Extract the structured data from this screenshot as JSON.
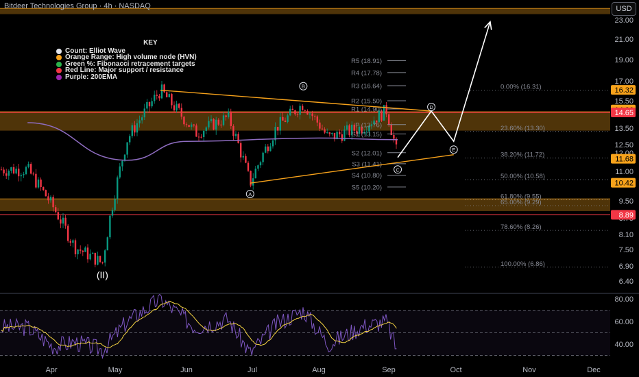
{
  "header": {
    "title": "Bitdeer Technologies Group · 4h · NASDAQ",
    "currency_button": "USD"
  },
  "key": {
    "title": "KEY",
    "items": [
      {
        "color": "#e0e3eb",
        "label": "Count: Elliot Wave"
      },
      {
        "color": "#f7a21b",
        "label": "Orange Range: High volume node (HVN)"
      },
      {
        "color": "#2bb24c",
        "label": "Green %: Fibonacci retracement targets"
      },
      {
        "color": "#f23645",
        "label": "Red Line: Major support / resistance"
      },
      {
        "color": "#9c27b0",
        "label": "Purple: 200EMA"
      }
    ]
  },
  "colors": {
    "up": "#089981",
    "down": "#f23645",
    "orange": "#f7a21b",
    "ema": "#8e6cc0",
    "pivot": "#868993",
    "fib": "#868993",
    "rsi": "#7e57c2",
    "rsi_ma": "#f5d442"
  },
  "chart_data": [
    {
      "type": "candlestick",
      "title": "Bitdeer Technologies Group · 4h · NASDAQ",
      "x_ticks": [
        "Apr",
        "May",
        "Jun",
        "Jul",
        "Aug",
        "Sep",
        "Oct",
        "Nov",
        "Dec"
      ],
      "y_ticks": [
        23.0,
        21.0,
        19.0,
        17.0,
        15.5,
        13.5,
        12.5,
        12.0,
        11.0,
        9.5,
        8.75,
        8.1,
        7.5,
        6.9,
        6.4
      ],
      "y_tick_labels": [
        "23.00",
        "21.00",
        "19.00",
        "17.00",
        "15.50",
        "13.50",
        "12.50",
        "12.00",
        "11.00",
        "9.50",
        "8.75",
        "8.10",
        "7.50",
        "6.90",
        "6.40"
      ],
      "price_labels": [
        {
          "value": "16.32",
          "color": "#f7a21b",
          "text": "#000"
        },
        {
          "value": "14.86",
          "color": "#f7a21b",
          "text": "#000"
        },
        {
          "value": "14.65",
          "color": "#f23645",
          "text": "#fff"
        },
        {
          "value": "11.68",
          "color": "#f7a21b",
          "text": "#000"
        },
        {
          "value": "10.42",
          "color": "#f7a21b",
          "text": "#000"
        },
        {
          "value": "8.89",
          "color": "#f23645",
          "text": "#fff"
        }
      ],
      "hvn_zones": [
        [
          23.6,
          24.2
        ],
        [
          13.35,
          14.7
        ],
        [
          9.05,
          9.6
        ]
      ],
      "red_lines": [
        14.65,
        8.89
      ],
      "pivots": [
        {
          "label": "R5 (18.91)",
          "value": 18.91
        },
        {
          "label": "R4 (17.78)",
          "value": 17.78
        },
        {
          "label": "R3 (16.64)",
          "value": 16.64
        },
        {
          "label": "R2 (15.50)",
          "value": 15.5
        },
        {
          "label": "R1 (14.90)",
          "value": 14.9
        },
        {
          "label": "P (13.76)",
          "value": 13.76
        },
        {
          "label": "S1 (13.15)",
          "value": 13.15
        },
        {
          "label": "S2 (12.01)",
          "value": 12.01
        },
        {
          "label": "S3 (11.41)",
          "value": 11.41
        },
        {
          "label": "S4 (10.80)",
          "value": 10.8
        },
        {
          "label": "S5 (10.20)",
          "value": 10.2
        }
      ],
      "fib_levels": [
        {
          "label": "0.00% (16.31)",
          "value": 16.31
        },
        {
          "label": "23.60% (13.30)",
          "value": 13.3
        },
        {
          "label": "38.20% (11.72)",
          "value": 11.72
        },
        {
          "label": "50.00% (10.58)",
          "value": 10.58
        },
        {
          "label": "61.80% (9.55)",
          "value": 9.55
        },
        {
          "label": "65.00% (9.29)",
          "value": 9.29
        },
        {
          "label": "78.60% (8.26)",
          "value": 8.26
        },
        {
          "label": "100.00% (6.86)",
          "value": 6.86
        }
      ],
      "wave_labels": [
        "(II)",
        "A",
        "B",
        "C",
        "D",
        "E"
      ],
      "triangle_lines": {
        "upper": [
          [
            "May 20",
            16.3
          ],
          [
            "Sep 20",
            14.75
          ]
        ],
        "lower": [
          [
            "Jun 30",
            10.4
          ],
          [
            "Sep 30",
            11.9
          ]
        ]
      },
      "projection_path": [
        [
          "Sep 05",
          11.75
        ],
        [
          "Sep 20",
          14.75
        ],
        [
          "Sep 30",
          12.7
        ],
        [
          "Oct 15",
          22.8
        ]
      ],
      "ohlc_key_points": [
        [
          "Mar 20",
          11.1
        ],
        [
          "Apr 02",
          9.2
        ],
        [
          "Apr 12",
          7.6
        ],
        [
          "Apr 25",
          7.0
        ],
        [
          "May 06",
          12.8
        ],
        [
          "May 20",
          16.3
        ],
        [
          "Jun 05",
          13.2
        ],
        [
          "Jun 20",
          14.3
        ],
        [
          "Jun 30",
          10.4
        ],
        [
          "Jul 12",
          13.6
        ],
        [
          "Jul 24",
          15.3
        ],
        [
          "Aug 05",
          12.9
        ],
        [
          "Aug 20",
          13.6
        ],
        [
          "Aug 30",
          14.8
        ],
        [
          "Sep 05",
          11.75
        ]
      ],
      "ema200_key_points": [
        [
          "Mar 20",
          13.9
        ],
        [
          "May 06",
          11.6
        ],
        [
          "Jun 01",
          12.7
        ],
        [
          "Aug 01",
          12.9
        ],
        [
          "Sep 05",
          12.8
        ]
      ]
    },
    {
      "type": "line",
      "title": "RSI",
      "y_ticks": [
        80.0,
        60.0,
        40.0
      ],
      "y_tick_labels": [
        "80.00",
        "60.00",
        "40.00"
      ],
      "bands": [
        70,
        50,
        30
      ],
      "rsi_key_points": [
        [
          "Mar 20",
          55
        ],
        [
          "Apr 02",
          38
        ],
        [
          "Apr 12",
          42
        ],
        [
          "Apr 25",
          35
        ],
        [
          "May 06",
          60
        ],
        [
          "May 20",
          80
        ],
        [
          "Jun 05",
          55
        ],
        [
          "Jun 20",
          62
        ],
        [
          "Jun 30",
          32
        ],
        [
          "Jul 12",
          58
        ],
        [
          "Jul 24",
          70
        ],
        [
          "Aug 05",
          40
        ],
        [
          "Aug 20",
          56
        ],
        [
          "Aug 30",
          60
        ],
        [
          "Sep 05",
          33
        ]
      ]
    }
  ]
}
